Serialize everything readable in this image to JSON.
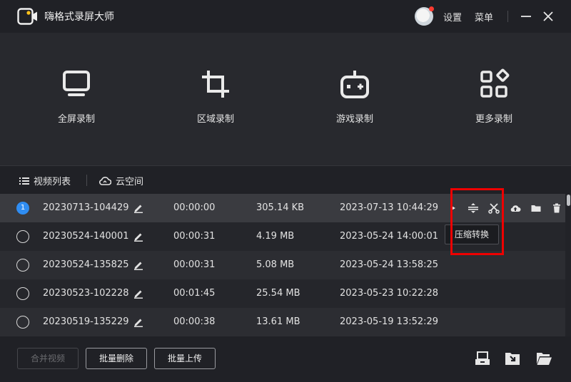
{
  "app": {
    "title": "嗨格式录屏大师"
  },
  "header": {
    "settings_label": "设置",
    "menu_label": "菜单"
  },
  "modes": [
    {
      "label": "全屏录制",
      "icon": "monitor-icon"
    },
    {
      "label": "区域录制",
      "icon": "crop-icon"
    },
    {
      "label": "游戏录制",
      "icon": "gamepad-icon"
    },
    {
      "label": "更多录制",
      "icon": "grid-icon"
    }
  ],
  "tabs": {
    "video_list": "视频列表",
    "cloud_space": "云空间"
  },
  "videos": [
    {
      "index": "1",
      "name": "20230713-104429",
      "duration": "00:00:00",
      "size": "305.14 KB",
      "date": "2023-07-13 10:44:29",
      "selected": true
    },
    {
      "name": "20230524-140001",
      "duration": "00:00:31",
      "size": "4.19 MB",
      "date": "2023-05-24 14:00:01"
    },
    {
      "name": "20230524-135825",
      "duration": "00:00:31",
      "size": "5.08 MB",
      "date": "2023-05-24 13:58:25"
    },
    {
      "name": "20230523-102228",
      "duration": "00:01:45",
      "size": "25.54 MB",
      "date": "2023-05-23 10:22:28"
    },
    {
      "name": "20230519-135229",
      "duration": "00:00:38",
      "size": "13.61 MB",
      "date": "2023-05-19 13:52:29"
    }
  ],
  "row_actions": [
    "play-icon",
    "compress-icon",
    "cut-icon",
    "upload-cloud-icon",
    "folder-icon",
    "delete-icon"
  ],
  "tooltip": {
    "text": "压缩转换"
  },
  "footer": {
    "merge_label": "合并视频",
    "batch_delete_label": "批量删除",
    "batch_upload_label": "批量上传"
  },
  "colors": {
    "accent": "#2f8df2",
    "highlight": "#ee0000",
    "background": "#202126"
  }
}
